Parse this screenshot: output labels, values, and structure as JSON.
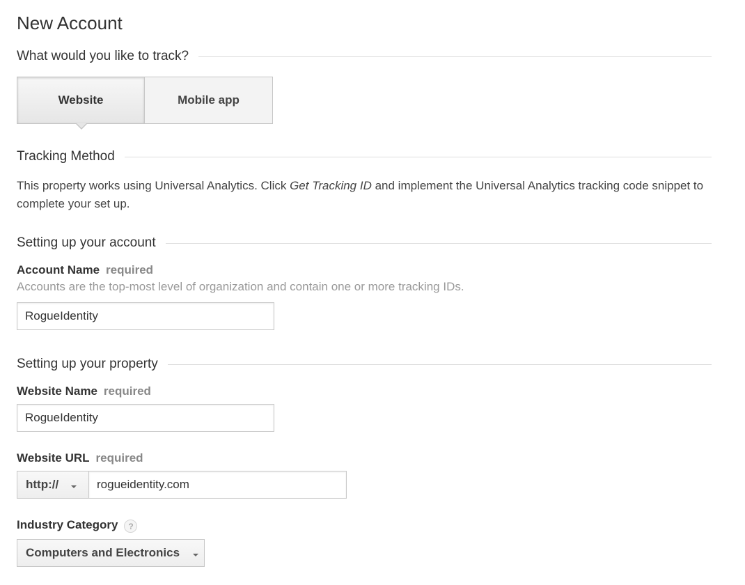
{
  "page": {
    "title": "New Account"
  },
  "track": {
    "heading": "What would you like to track?",
    "options": [
      "Website",
      "Mobile app"
    ],
    "selected": "Website"
  },
  "tracking_method": {
    "heading": "Tracking Method",
    "text_before": "This property works using Universal Analytics. Click ",
    "text_emphasis": "Get Tracking ID",
    "text_after": " and implement the Universal Analytics tracking code snippet to complete your set up."
  },
  "account": {
    "heading": "Setting up your account",
    "name_label": "Account Name",
    "required_label": "required",
    "helper": "Accounts are the top-most level of organization and contain one or more tracking IDs.",
    "name_value": "RogueIdentity"
  },
  "property": {
    "heading": "Setting up your property",
    "website_name_label": "Website Name",
    "required_label": "required",
    "website_name_value": "RogueIdentity",
    "website_url_label": "Website URL",
    "protocol": "http://",
    "url_value": "rogueidentity.com",
    "industry_label": "Industry Category",
    "help_glyph": "?",
    "industry_value": "Computers and Electronics"
  }
}
